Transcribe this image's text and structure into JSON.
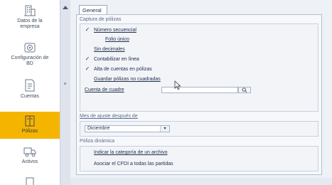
{
  "sidebar": {
    "items": [
      {
        "label": "Datos de la\nempresa",
        "icon": "building-icon"
      },
      {
        "label": "Configuración de\nBD",
        "icon": "database-config-icon"
      },
      {
        "label": "Cuentas",
        "icon": "accounts-document-icon"
      },
      {
        "label": "Pólizas",
        "icon": "policies-book-icon",
        "active": true
      },
      {
        "label": "Activos",
        "icon": "assets-truck-icon"
      },
      {
        "label": "",
        "icon": "extra-icon"
      }
    ]
  },
  "main": {
    "tab_label": "General",
    "captura": {
      "title": "Captura de pólizas",
      "options": [
        {
          "label": "Número secuencial",
          "checked": true
        },
        {
          "label": "Folio único",
          "checked": false
        },
        {
          "label": "Sin decimales",
          "checked": false
        },
        {
          "label": "Contabilizar en línea",
          "checked": true
        },
        {
          "label": "Alta de cuentas en pólizas",
          "checked": true
        },
        {
          "label": "Guardar pólizas no cuadradas",
          "checked": false
        }
      ],
      "cuenta_label": "Cuenta de cuadre",
      "cuenta_value": ""
    },
    "mes": {
      "title": "Mes de ajuste después de",
      "selected": "Diciembre"
    },
    "dinamica": {
      "title": "Póliza dinámica",
      "options": [
        {
          "label": "Indicar la categoría de un archivo",
          "checked": false
        },
        {
          "label": "Asociar el CFDI a todas las partidas",
          "checked": false
        }
      ]
    }
  },
  "colors": {
    "active_nav": "#f4b400",
    "panel_border": "#b3bed0",
    "accent_text": "#5b6c8c"
  }
}
